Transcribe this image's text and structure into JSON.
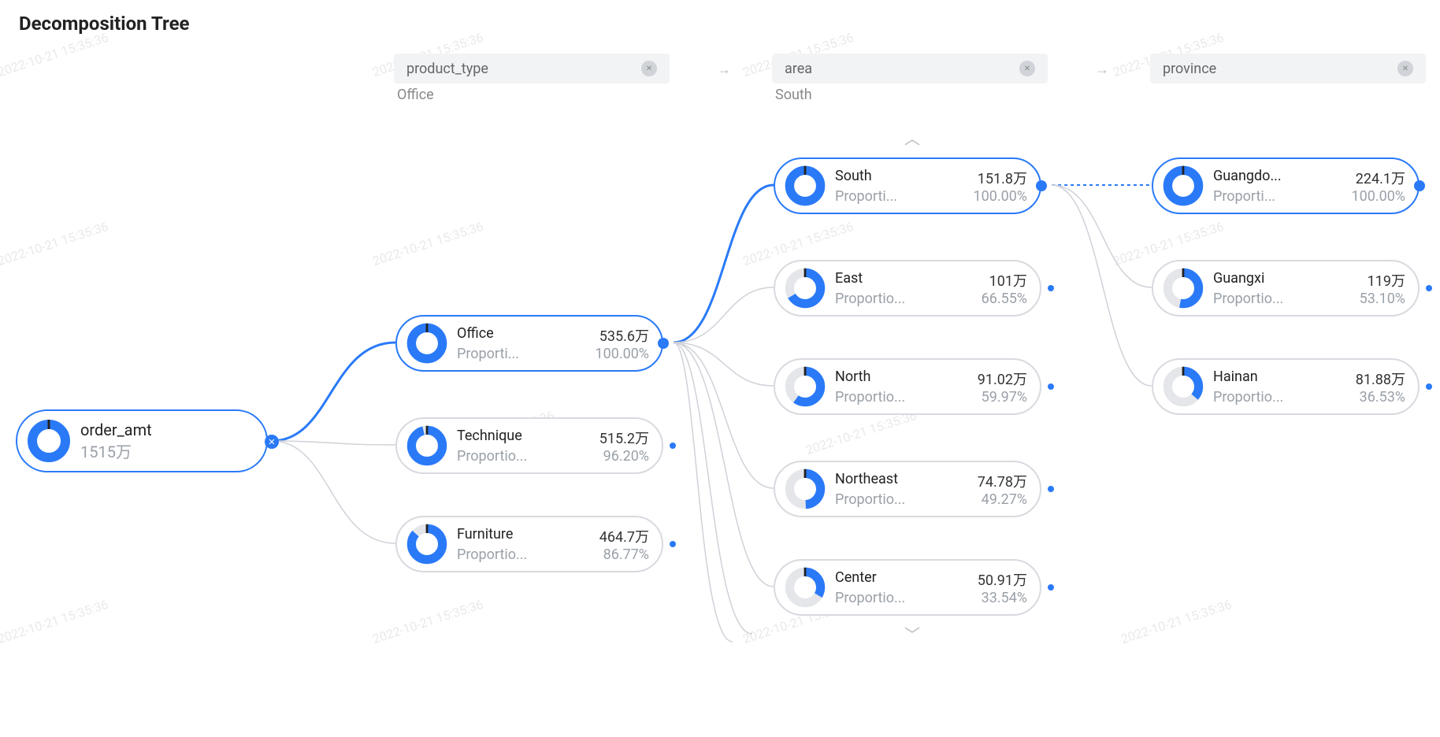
{
  "title": "Decomposition Tree",
  "watermark": "2022-10-21 15:35:36",
  "labels": {
    "proportion": "Proporti...",
    "proportion_full": "Proportio..."
  },
  "breadcrumbs": [
    {
      "field": "product_type",
      "selected": "Office"
    },
    {
      "field": "area",
      "selected": "South"
    },
    {
      "field": "province",
      "selected": ""
    }
  ],
  "root": {
    "name": "order_amt",
    "value": "1515万"
  },
  "levels": {
    "product_type": [
      {
        "name": "Office",
        "value": "535.6万",
        "pct": "100.00%",
        "pctNum": 100,
        "selected": true
      },
      {
        "name": "Technique",
        "value": "515.2万",
        "pct": "96.20%",
        "pctNum": 96.2,
        "selected": false
      },
      {
        "name": "Furniture",
        "value": "464.7万",
        "pct": "86.77%",
        "pctNum": 86.77,
        "selected": false
      }
    ],
    "area": [
      {
        "name": "South",
        "value": "151.8万",
        "pct": "100.00%",
        "pctNum": 100,
        "selected": true
      },
      {
        "name": "East",
        "value": "101万",
        "pct": "66.55%",
        "pctNum": 66.55,
        "selected": false
      },
      {
        "name": "North",
        "value": "91.02万",
        "pct": "59.97%",
        "pctNum": 59.97,
        "selected": false
      },
      {
        "name": "Northeast",
        "value": "74.78万",
        "pct": "49.27%",
        "pctNum": 49.27,
        "selected": false
      },
      {
        "name": "Center",
        "value": "50.91万",
        "pct": "33.54%",
        "pctNum": 33.54,
        "selected": false
      }
    ],
    "province": [
      {
        "name": "Guangdo...",
        "value": "224.1万",
        "pct": "100.00%",
        "pctNum": 100,
        "selected": true
      },
      {
        "name": "Guangxi",
        "value": "119万",
        "pct": "53.10%",
        "pctNum": 53.1,
        "selected": false
      },
      {
        "name": "Hainan",
        "value": "81.88万",
        "pct": "36.53%",
        "pctNum": 36.53,
        "selected": false
      }
    ]
  },
  "chart_data": {
    "type": "table",
    "title": "Decomposition Tree — order_amt = 1515万",
    "root": {
      "metric": "order_amt",
      "value_wan": 1515
    },
    "levels": [
      {
        "field": "product_type",
        "rows": [
          {
            "name": "Office",
            "value_wan": 535.6,
            "proportion_pct": 100.0,
            "selected": true
          },
          {
            "name": "Technique",
            "value_wan": 515.2,
            "proportion_pct": 96.2
          },
          {
            "name": "Furniture",
            "value_wan": 464.7,
            "proportion_pct": 86.77
          }
        ]
      },
      {
        "field": "area",
        "rows": [
          {
            "name": "South",
            "value_wan": 151.8,
            "proportion_pct": 100.0,
            "selected": true
          },
          {
            "name": "East",
            "value_wan": 101,
            "proportion_pct": 66.55
          },
          {
            "name": "North",
            "value_wan": 91.02,
            "proportion_pct": 59.97
          },
          {
            "name": "Northeast",
            "value_wan": 74.78,
            "proportion_pct": 49.27
          },
          {
            "name": "Center",
            "value_wan": 50.91,
            "proportion_pct": 33.54
          }
        ]
      },
      {
        "field": "province",
        "rows": [
          {
            "name": "Guangdong",
            "value_wan": 224.1,
            "proportion_pct": 100.0,
            "selected": true
          },
          {
            "name": "Guangxi",
            "value_wan": 119,
            "proportion_pct": 53.1
          },
          {
            "name": "Hainan",
            "value_wan": 81.88,
            "proportion_pct": 36.53
          }
        ]
      }
    ]
  }
}
